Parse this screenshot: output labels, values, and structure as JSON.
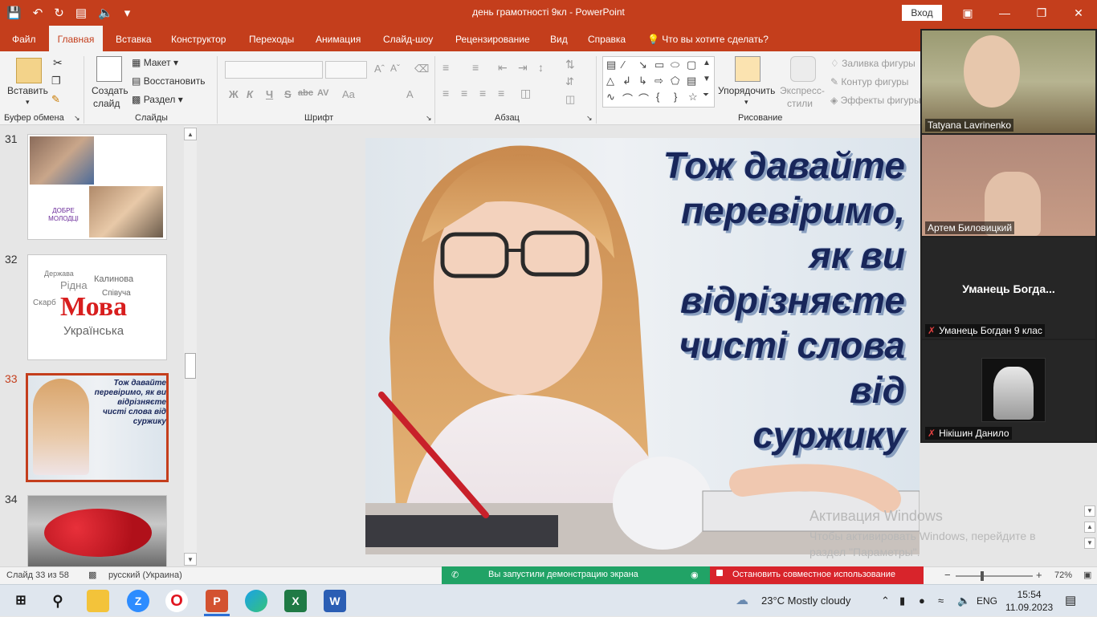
{
  "titlebar": {
    "title": "день грамотності 9кл  -  PowerPoint",
    "signin": "Вход",
    "qat_icons": [
      "save-icon",
      "undo-icon",
      "redo-icon",
      "present-icon",
      "speaker-icon",
      "customize-icon"
    ]
  },
  "tabs": [
    "Файл",
    "Главная",
    "Вставка",
    "Конструктор",
    "Переходы",
    "Анимация",
    "Слайд-шоу",
    "Рецензирование",
    "Вид",
    "Справка"
  ],
  "active_tab": "Главная",
  "tellme": "Что вы хотите сделать?",
  "ribbon": {
    "paste": "Вставить",
    "clipboard": "Буфер обмена",
    "new_slide_1": "Создать",
    "new_slide_2": "слайд",
    "layout": "Макет",
    "reset": "Восстановить",
    "section": "Раздел",
    "slides": "Слайды",
    "font": "Шрифт",
    "paragraph": "Абзац",
    "arrange": "Упорядочить",
    "quick_styles_1": "Экспресс-",
    "quick_styles_2": "стили",
    "shape_fill": "Заливка фигуры",
    "shape_outline": "Контур фигуры",
    "shape_effects": "Эффекты фигуры",
    "drawing": "Рисование",
    "font_format": [
      "Ж",
      "К",
      "Ч",
      "S",
      "abc",
      "AV",
      "Aa",
      "A"
    ]
  },
  "thumbs": {
    "n31": "31",
    "n32": "32",
    "n33": "33",
    "n34": "34",
    "t31_line1": "ДОБРЕ",
    "t31_line2": "МОЛОДЦІ",
    "t32_word": "Мова",
    "t32_words": [
      "Рідна",
      "Калинова",
      "Співуча",
      "Українська",
      "Скарб",
      "Держава"
    ],
    "t33_text": "Тож давайте перевіримо, як ви відрізняєте чисті слова від суржику"
  },
  "slide": {
    "lines": [
      "Тож давайте",
      "перевіримо,",
      "як ви",
      "відрізняєте",
      "чисті слова",
      "від",
      "суржику"
    ]
  },
  "activation": {
    "line1": "Активация Windows",
    "line2": "Чтобы активировать Windows, перейдите в",
    "line3": "раздел \"Параметры\"."
  },
  "meeting": {
    "p1": "Tatyana Lavrinenko",
    "p2": "Артем Биловицкий",
    "p3_big": "Уманець  Богда...",
    "p3": "Уманець Богдан 9 клас",
    "p4": "Нікішин Данило"
  },
  "status": {
    "slide_of": "Слайд 33 из 58",
    "language": "русский (Украина)",
    "sharing": "Вы запустили демонстрацию экрана",
    "stop_sharing": "Остановить совместное использование",
    "zoom": "72%",
    "zoom_level": 0.72
  },
  "taskbar": {
    "weather": "23°C  Mostly cloudy",
    "lang": "ENG",
    "time": "15:54",
    "date": "11.09.2023"
  },
  "colors": {
    "accent": "#c43e1c",
    "slide_text": "#18265a",
    "share_green": "#21a366",
    "share_red": "#d8242b"
  }
}
